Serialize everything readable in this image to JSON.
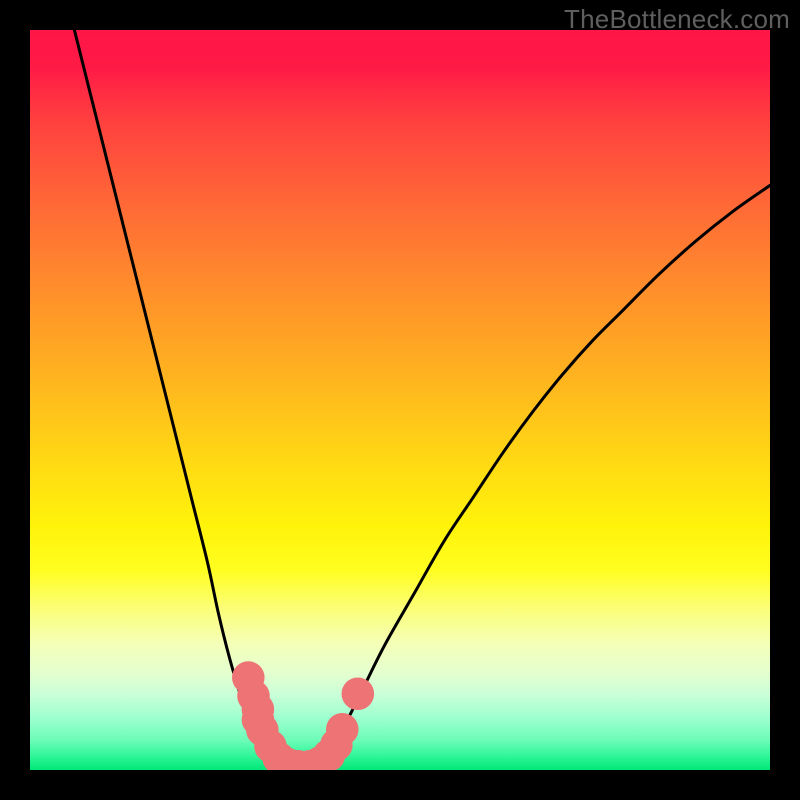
{
  "watermark": "TheBottleneck.com",
  "colors": {
    "frame": "#000000",
    "curve": "#000000",
    "marker_fill": "#ed7374",
    "gradient_stops": [
      "#ff1648",
      "#ff3f3f",
      "#ff6a36",
      "#ff8e2b",
      "#ffb41f",
      "#ffd814",
      "#fff30a",
      "#fffe20",
      "#fbfe75",
      "#f4ffb8",
      "#e4ffd0",
      "#c7ffd8",
      "#9dffcf",
      "#6cfcb8",
      "#33f69a",
      "#00e877"
    ]
  },
  "chart_data": {
    "type": "line",
    "title": "",
    "xlabel": "",
    "ylabel": "",
    "xlim": [
      0,
      100
    ],
    "ylim": [
      0,
      100
    ],
    "series": [
      {
        "name": "left-branch",
        "x": [
          6,
          8,
          10,
          12,
          14,
          16,
          18,
          20,
          22,
          24,
          25.5,
          27,
          28.5,
          30,
          31,
          32,
          33,
          34
        ],
        "y": [
          100,
          92,
          84,
          76,
          68,
          60,
          52,
          44,
          36,
          28,
          21,
          15,
          10,
          6,
          3.5,
          1.8,
          0.6,
          0.1
        ]
      },
      {
        "name": "right-branch",
        "x": [
          38,
          39.5,
          41,
          43,
          45,
          48,
          52,
          56,
          60,
          64,
          68,
          72,
          76,
          80,
          85,
          90,
          95,
          100
        ],
        "y": [
          0.1,
          1.2,
          3.5,
          7,
          11,
          17,
          24,
          31,
          37,
          43,
          48.5,
          53.5,
          58,
          62,
          67,
          71.5,
          75.5,
          79
        ]
      },
      {
        "name": "valley-floor",
        "x": [
          34,
          35,
          36,
          37,
          38
        ],
        "y": [
          0.1,
          0,
          0,
          0,
          0.1
        ]
      }
    ],
    "markers": [
      {
        "x": 29.5,
        "y": 12.5,
        "r": 2.2
      },
      {
        "x": 30.2,
        "y": 10.0,
        "r": 2.2
      },
      {
        "x": 30.8,
        "y": 8.2,
        "r": 2.2
      },
      {
        "x": 30.8,
        "y": 6.8,
        "r": 2.2
      },
      {
        "x": 31.4,
        "y": 5.4,
        "r": 2.2
      },
      {
        "x": 32.5,
        "y": 3.2,
        "r": 2.2
      },
      {
        "x": 33.6,
        "y": 1.6,
        "r": 2.2
      },
      {
        "x": 34.8,
        "y": 0.8,
        "r": 2.2
      },
      {
        "x": 36.2,
        "y": 0.5,
        "r": 2.2
      },
      {
        "x": 37.8,
        "y": 0.5,
        "r": 2.2
      },
      {
        "x": 39.2,
        "y": 1.0,
        "r": 2.2
      },
      {
        "x": 40.4,
        "y": 2.0,
        "r": 2.2
      },
      {
        "x": 41.4,
        "y": 3.4,
        "r": 2.2
      },
      {
        "x": 42.2,
        "y": 5.5,
        "r": 2.2
      },
      {
        "x": 44.3,
        "y": 10.3,
        "r": 2.2
      }
    ]
  }
}
